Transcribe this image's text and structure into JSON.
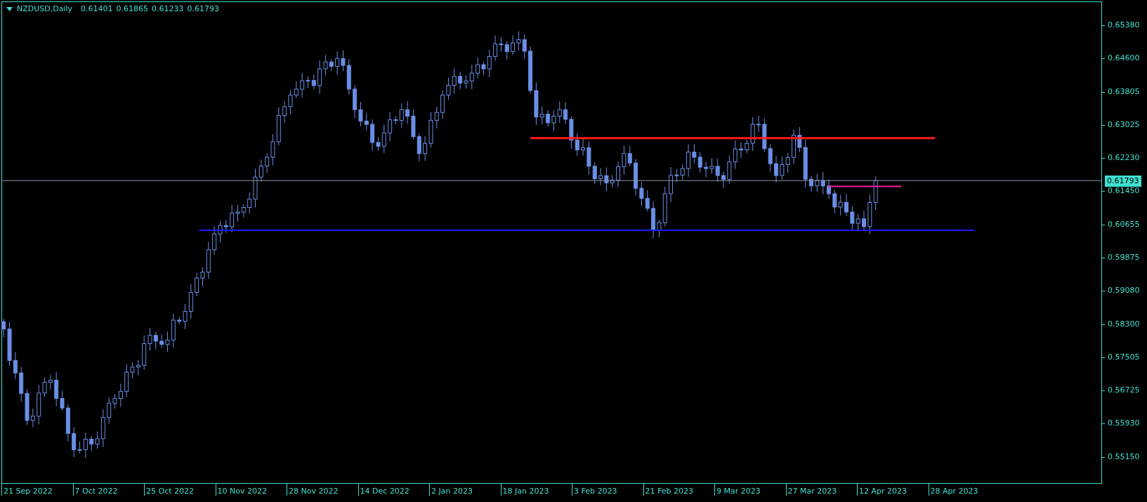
{
  "header": {
    "symbol": "NZDUSD,Daily",
    "values": [
      "0.61401",
      "0.61865",
      "0.61233",
      "0.61793"
    ]
  },
  "price_axis": {
    "labels": [
      "0.65380",
      "0.64600",
      "0.63805",
      "0.63025",
      "0.62230",
      "0.61450",
      "0.60655",
      "0.59875",
      "0.59080",
      "0.58300",
      "0.57505",
      "0.56725",
      "0.55930",
      "0.55150"
    ],
    "current_price": "0.61793"
  },
  "time_axis": {
    "labels": [
      "21 Sep 2022",
      "7 Oct 2022",
      "25 Oct 2022",
      "10 Nov 2022",
      "28 Nov 2022",
      "14 Dec 2022",
      "2 Jan 2023",
      "18 Jan 2023",
      "3 Feb 2023",
      "21 Feb 2023",
      "9 Mar 2023",
      "27 Mar 2023",
      "12 Apr 2023",
      "28 Apr 2023"
    ]
  }
}
